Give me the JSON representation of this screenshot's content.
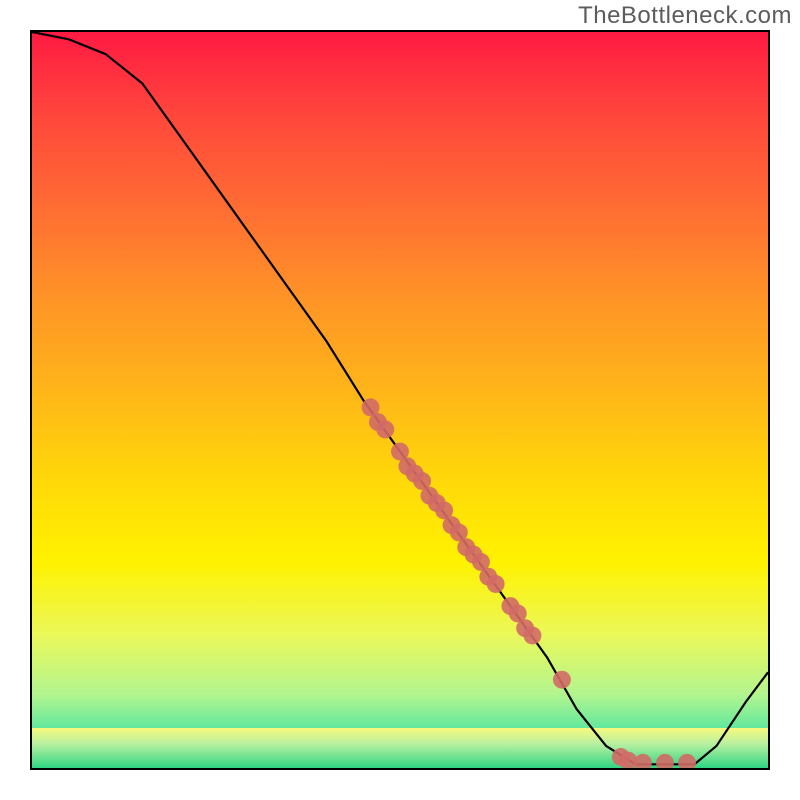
{
  "watermark": "TheBottleneck.com",
  "chart_data": {
    "type": "line",
    "title": "",
    "xlabel": "",
    "ylabel": "",
    "xlim": [
      0,
      100
    ],
    "ylim": [
      0,
      100
    ],
    "grid": false,
    "legend": false,
    "curve": [
      {
        "x": 0,
        "y": 100
      },
      {
        "x": 5,
        "y": 99
      },
      {
        "x": 10,
        "y": 97
      },
      {
        "x": 15,
        "y": 93
      },
      {
        "x": 20,
        "y": 86
      },
      {
        "x": 25,
        "y": 79
      },
      {
        "x": 30,
        "y": 72
      },
      {
        "x": 35,
        "y": 65
      },
      {
        "x": 40,
        "y": 58
      },
      {
        "x": 45,
        "y": 50
      },
      {
        "x": 50,
        "y": 43
      },
      {
        "x": 55,
        "y": 36
      },
      {
        "x": 60,
        "y": 29
      },
      {
        "x": 65,
        "y": 22
      },
      {
        "x": 70,
        "y": 15
      },
      {
        "x": 74,
        "y": 8
      },
      {
        "x": 78,
        "y": 3
      },
      {
        "x": 82,
        "y": 0.5
      },
      {
        "x": 86,
        "y": 0.5
      },
      {
        "x": 90,
        "y": 0.5
      },
      {
        "x": 93,
        "y": 3
      },
      {
        "x": 97,
        "y": 9
      },
      {
        "x": 100,
        "y": 13
      }
    ],
    "scatter": [
      {
        "x": 46,
        "y": 49
      },
      {
        "x": 47,
        "y": 47
      },
      {
        "x": 48,
        "y": 46
      },
      {
        "x": 50,
        "y": 43
      },
      {
        "x": 51,
        "y": 41
      },
      {
        "x": 52,
        "y": 40
      },
      {
        "x": 53,
        "y": 39
      },
      {
        "x": 54,
        "y": 37
      },
      {
        "x": 55,
        "y": 36
      },
      {
        "x": 56,
        "y": 35
      },
      {
        "x": 57,
        "y": 33
      },
      {
        "x": 58,
        "y": 32
      },
      {
        "x": 59,
        "y": 30
      },
      {
        "x": 60,
        "y": 29
      },
      {
        "x": 61,
        "y": 28
      },
      {
        "x": 62,
        "y": 26
      },
      {
        "x": 63,
        "y": 25
      },
      {
        "x": 65,
        "y": 22
      },
      {
        "x": 66,
        "y": 21
      },
      {
        "x": 67,
        "y": 19
      },
      {
        "x": 68,
        "y": 18
      },
      {
        "x": 72,
        "y": 12
      },
      {
        "x": 80,
        "y": 1.5
      },
      {
        "x": 81,
        "y": 1.0
      },
      {
        "x": 83,
        "y": 0.7
      },
      {
        "x": 86,
        "y": 0.7
      },
      {
        "x": 89,
        "y": 0.7
      }
    ],
    "dot_color": "#d16a66",
    "line_color": "#000000"
  }
}
